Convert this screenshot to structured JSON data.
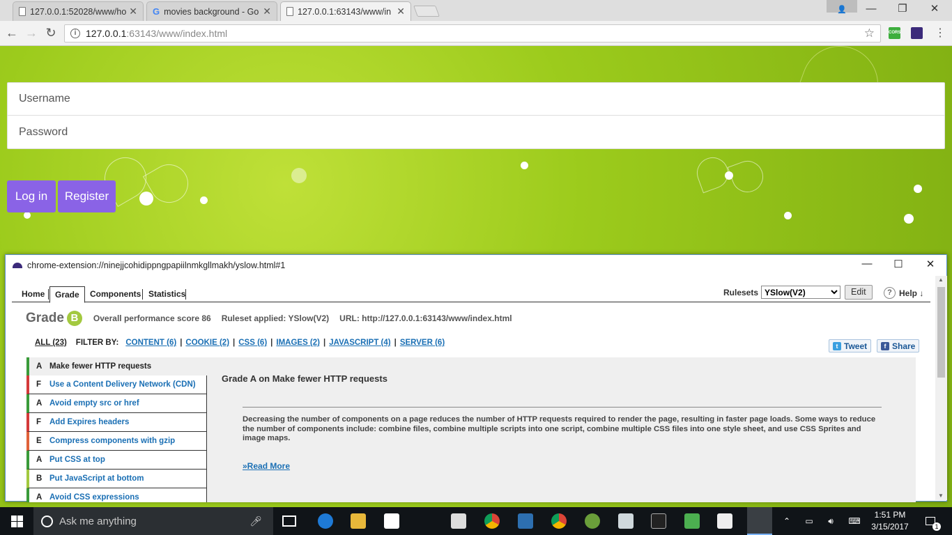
{
  "browser": {
    "tabs": [
      {
        "title": "127.0.0.1:52028/www/ho",
        "icon": "document-icon"
      },
      {
        "title": "movies background - Go",
        "icon": "google-icon"
      },
      {
        "title": "127.0.0.1:63143/www/in",
        "icon": "document-icon",
        "active": true
      }
    ],
    "url_host": "127.0.0.1",
    "url_rest": ":63143/www/index.html"
  },
  "page": {
    "username_placeholder": "Username",
    "password_placeholder": "Password",
    "login_label": "Log in",
    "register_label": "Register",
    "button_color": "#8a63e6"
  },
  "yslow": {
    "window_title": "chrome-extension://ninejjcohidippngpapiilnmkgllmakh/yslow.html#1",
    "tabs": [
      "Home",
      "Grade",
      "Components",
      "Statistics"
    ],
    "active_tab": "Grade",
    "rulesets_label": "Rulesets",
    "ruleset_value": "YSlow(V2)",
    "edit_label": "Edit",
    "help_label": "Help ↓",
    "grade_label": "Grade",
    "grade_value": "B",
    "overall_score": "Overall performance score 86",
    "ruleset_applied": "Ruleset applied: YSlow(V2)",
    "url_info": "URL: http://127.0.0.1:63143/www/index.html",
    "filter": {
      "all": "ALL (23)",
      "filter_by": "FILTER BY:",
      "links": [
        "CONTENT (6)",
        "COOKIE (2)",
        "CSS (6)",
        "IMAGES (2)",
        "JAVASCRIPT (4)",
        "SERVER (6)"
      ]
    },
    "tweet_label": "Tweet",
    "share_label": "Share",
    "rules": [
      {
        "grade": "A",
        "title": "Make fewer HTTP requests",
        "color": "#3a9b3a"
      },
      {
        "grade": "F",
        "title": "Use a Content Delivery Network (CDN)",
        "color": "#d43a3a"
      },
      {
        "grade": "A",
        "title": "Avoid empty src or href",
        "color": "#3a9b3a"
      },
      {
        "grade": "F",
        "title": "Add Expires headers",
        "color": "#d43a3a"
      },
      {
        "grade": "E",
        "title": "Compress components with gzip",
        "color": "#e0623a"
      },
      {
        "grade": "A",
        "title": "Put CSS at top",
        "color": "#3a9b3a"
      },
      {
        "grade": "B",
        "title": "Put JavaScript at bottom",
        "color": "#a3c93f"
      },
      {
        "grade": "A",
        "title": "Avoid CSS expressions",
        "color": "#3a9b3a"
      }
    ],
    "detail_title": "Grade A on Make fewer HTTP requests",
    "detail_text": "Decreasing the number of components on a page reduces the number of HTTP requests required to render the page, resulting in faster page loads. Some ways to reduce the number of components include: combine files, combine multiple scripts into one script, combine multiple CSS files into one style sheet, and use CSS Sprites and image maps.",
    "read_more": "»Read More"
  },
  "taskbar": {
    "search_placeholder": "Ask me anything",
    "time": "1:51 PM",
    "date": "3/15/2017",
    "notification_count": "1"
  }
}
